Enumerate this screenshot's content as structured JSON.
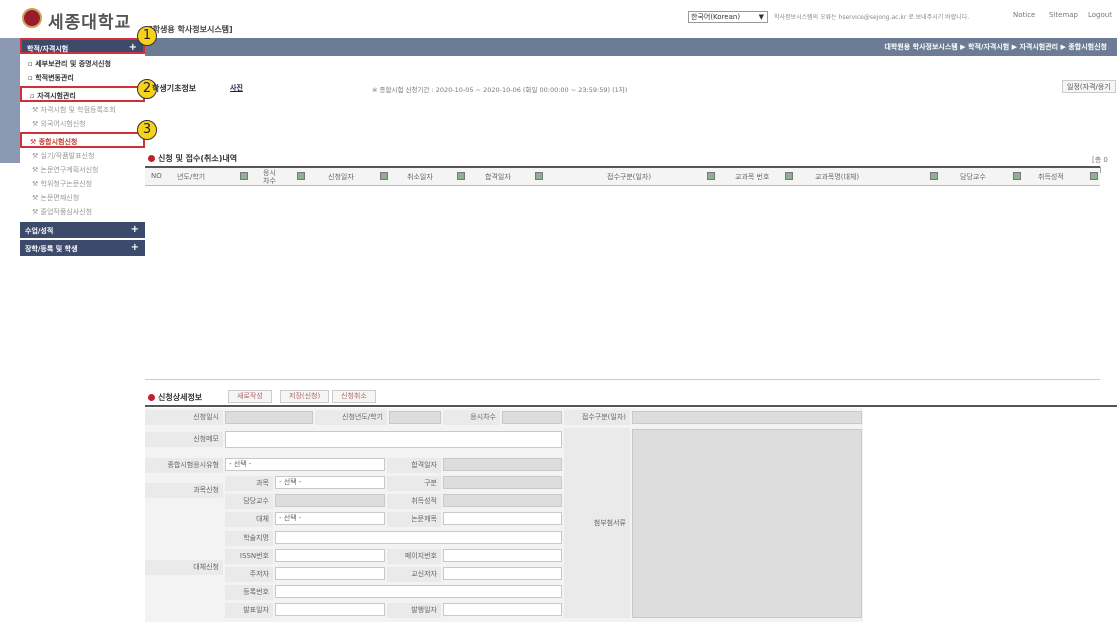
{
  "header": {
    "logo_text": "세종대학교",
    "system_title": "[학생용 학사정보시스템]",
    "language": "한국어(Korean)",
    "message": "학사정보시스템의 오류는 hservice@sejong.ac.kr 로 보내주시기 바랍니다.",
    "links": [
      "Notice",
      "Sitemap",
      "Logout"
    ]
  },
  "breadcrumb": "대학원용 학사정보시스템 ▶ 학적/자격시험 ▶ 자격시험관리 ▶ 종합시험신청",
  "sidebar": {
    "menu1": "학적/자격시험",
    "items": [
      "세부보관리 및 증명서신청",
      "학적변동관리",
      "자격시험관리",
      "자격시험 및 학점등록조회",
      "외국어시험신청",
      "종합시험신청",
      "실기/작품발표신청",
      "논문연구계획서신청",
      "학위청구논문신청",
      "논문면제신청",
      "졸업작품심사신청"
    ],
    "menu2": "수업/성적",
    "menu3": "장학/등록 및 학생"
  },
  "callouts": [
    "1",
    "2",
    "3"
  ],
  "student_info": {
    "title": "학생기초정보",
    "photo_label": "사진",
    "period": "※ 종합시험 신청기간 : 2020-10-05 ~ 2020-10-06 (화일 00:00:00 ~ 23:59:59) (1차)",
    "button": "일정(자격/응기"
  },
  "grid": {
    "title": "신청 및 접수(취소)내역",
    "count": "[총 0건]",
    "headers": [
      "NO",
      "년도/학기",
      "응시차수",
      "신청일자",
      "취소일자",
      "합격일자",
      "접수구분(일자)",
      "교과목 번호",
      "교과목명(대체)",
      "담당교수",
      "취득성적"
    ]
  },
  "detail": {
    "title": "신청상세정보",
    "buttons": [
      "새로작성",
      "저장(신청)",
      "신청취소"
    ],
    "labels": {
      "apply_date": "신청일시",
      "year_term": "신청년도/학기",
      "round": "응시차수",
      "receipt": "접수구분(일자)",
      "memo": "신청메모",
      "exam_type": "종합시험응시유형",
      "pass_date": "합격일자",
      "course_apply": "과목신청",
      "subject": "과목",
      "division": "구분",
      "professor": "담당교수",
      "grade": "취득성적",
      "substitute": "대체",
      "thesis_title": "논문제목",
      "journal": "학술지명",
      "issn": "ISSN번호",
      "page_no": "페이지번호",
      "author": "주저자",
      "co_author": "교신저자",
      "reg_no": "등록번호",
      "sub_apply": "대체신청",
      "pub_date": "발표일자",
      "issue_date": "발행일자",
      "attachments": "첨부첨서류"
    },
    "select_placeholder": "- 선택 -"
  }
}
